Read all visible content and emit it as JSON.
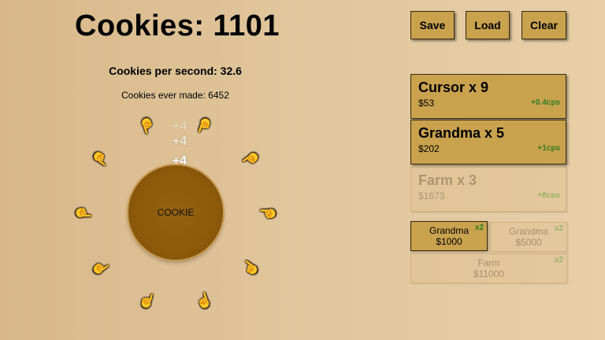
{
  "stats": {
    "cookies_label": "Cookies: 1101",
    "cps_label": "Cookies per second: 32.6",
    "ever_label": "Cookies ever made: 6452"
  },
  "floaters": [
    "+4",
    "+4",
    "+4"
  ],
  "cookie": {
    "label": "COOKIE"
  },
  "orbit_cursors": {
    "count": 10,
    "icon": "pointing-hand-icon"
  },
  "toolbar": {
    "save": "Save",
    "load": "Load",
    "clear": "Clear"
  },
  "buildings": [
    {
      "name": "Cursor x 9",
      "price": "$53",
      "rate": "+0.4cps",
      "affordable": true
    },
    {
      "name": "Grandma x 5",
      "price": "$202",
      "rate": "+1cps",
      "affordable": true
    },
    {
      "name": "Farm x 3",
      "price": "$1673",
      "rate": "+8cps",
      "affordable": false
    }
  ],
  "upgrades": [
    {
      "name": "Grandma",
      "price": "$1000",
      "mult": "x2",
      "affordable": true
    },
    {
      "name": "Grandma",
      "price": "$5000",
      "mult": "x2",
      "affordable": false
    },
    {
      "name": "Farm",
      "price": "$11000",
      "mult": "x2",
      "affordable": false
    }
  ],
  "colors": {
    "button": "#c9a24e",
    "rate_green": "#2e7d1c",
    "cookie": "#8d5a0b"
  }
}
